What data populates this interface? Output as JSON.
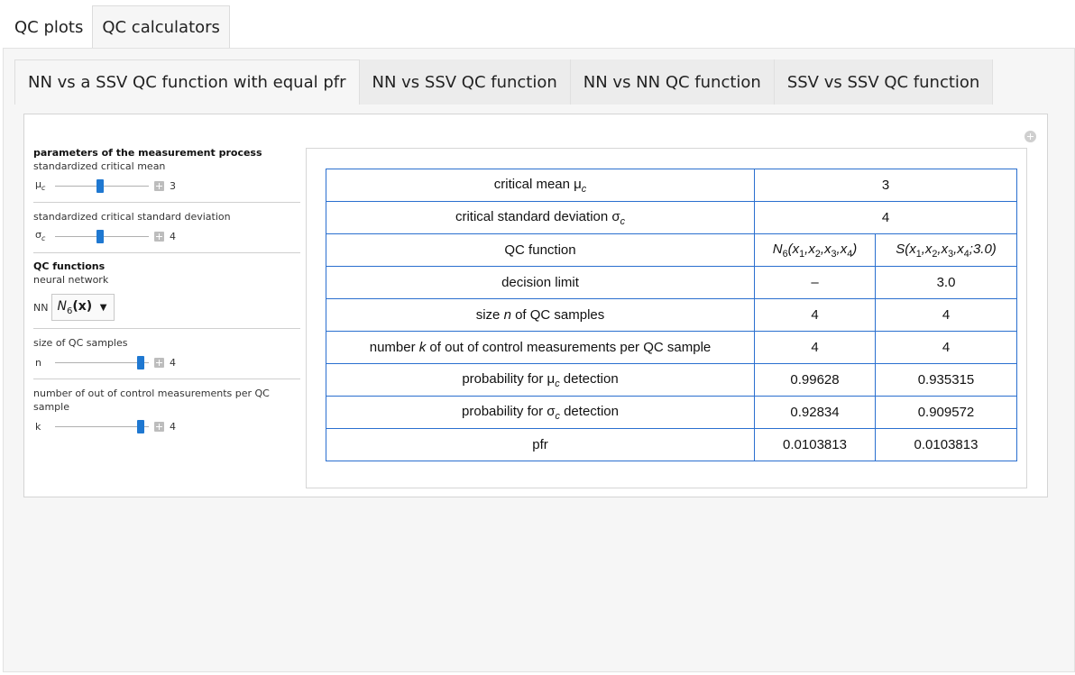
{
  "top_tabs": [
    {
      "label": "QC plots",
      "active": false
    },
    {
      "label": "QC calculators",
      "active": true
    }
  ],
  "sub_tabs": [
    {
      "label": "NN vs a SSV QC function with equal pfr",
      "active": true
    },
    {
      "label": "NN vs SSV QC function",
      "active": false
    },
    {
      "label": "NN vs NN QC function",
      "active": false
    },
    {
      "label": "SSV vs SSV QC function",
      "active": false
    }
  ],
  "controls": {
    "measurement_title": "parameters of the measurement process",
    "mean_caption": "standardized critical mean",
    "mu_symbol": "μ",
    "mu_sub": "c",
    "mu_value": "3",
    "mu_fraction": 0.48,
    "sd_caption": "standardized critical standard deviation",
    "sigma_symbol": "σ",
    "sigma_sub": "c",
    "sigma_value": "4",
    "sigma_fraction": 0.48,
    "qc_title": "QC functions",
    "nn_caption": "neural network",
    "nn_label": "NN",
    "nn_selected_main": "N",
    "nn_selected_sub": "6",
    "nn_selected_arg": "(x)",
    "n_caption": "size of QC samples",
    "n_label": "n",
    "n_value": "4",
    "n_fraction": 0.95,
    "k_caption": "number of out of control measurements per QC sample",
    "k_label": "k",
    "k_value": "4",
    "k_fraction": 0.95
  },
  "table": {
    "critical_mean_label": "critical mean μ",
    "critical_mean_sub": "c",
    "critical_mean_value": "3",
    "critical_sd_label": "critical standard deviation σ",
    "critical_sd_sub": "c",
    "critical_sd_value": "4",
    "qc_function_label": "QC function",
    "qc_nn": "N6(x1,x2,x3,x4)",
    "qc_ssv": "S(x1,x2,x3,x4;3.0)",
    "decision_limit_label": "decision limit",
    "decision_limit_nn": "–",
    "decision_limit_ssv": "3.0",
    "size_label_pre": "size ",
    "size_label_var": "n",
    "size_label_post": " of QC samples",
    "size_nn": "4",
    "size_ssv": "4",
    "number_label_pre": "number ",
    "number_label_var": "k",
    "number_label_post": " of out of control measurements per QC sample",
    "number_nn": "4",
    "number_ssv": "4",
    "prob_mu_label": "probability for μ",
    "prob_mu_sub": "c",
    "prob_mu_label_post": " detection",
    "prob_mu_nn": "0.99628",
    "prob_mu_ssv": "0.935315",
    "prob_sigma_label": "probability for σ",
    "prob_sigma_sub": "c",
    "prob_sigma_label_post": " detection",
    "prob_sigma_nn": "0.92834",
    "prob_sigma_ssv": "0.909572",
    "pfr_label": "pfr",
    "pfr_nn": "0.0103813",
    "pfr_ssv": "0.0103813"
  },
  "colors": {
    "accent": "#1f78d1",
    "table_border": "#2a6fcf"
  }
}
